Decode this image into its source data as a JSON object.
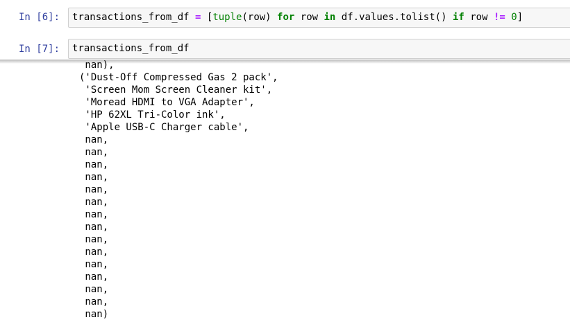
{
  "cells": [
    {
      "prompt": "In [6]:",
      "code_tokens": [
        {
          "text": "transactions_from_df ",
          "cls": ""
        },
        {
          "text": "=",
          "cls": "op"
        },
        {
          "text": " [",
          "cls": ""
        },
        {
          "text": "tuple",
          "cls": "builtin"
        },
        {
          "text": "(row) ",
          "cls": ""
        },
        {
          "text": "for",
          "cls": "kw"
        },
        {
          "text": " row ",
          "cls": ""
        },
        {
          "text": "in",
          "cls": "kw"
        },
        {
          "text": " df.values.tolist() ",
          "cls": ""
        },
        {
          "text": "if",
          "cls": "kw"
        },
        {
          "text": " row ",
          "cls": ""
        },
        {
          "text": "!=",
          "cls": "op"
        },
        {
          "text": " ",
          "cls": ""
        },
        {
          "text": "0",
          "cls": "num"
        },
        {
          "text": "]",
          "cls": ""
        }
      ]
    },
    {
      "prompt": "In [7]:",
      "code_tokens": [
        {
          "text": "transactions_from_df",
          "cls": ""
        }
      ]
    }
  ],
  "output": {
    "lines": [
      " nan),",
      "('Dust-Off Compressed Gas 2 pack',",
      " 'Screen Mom Screen Cleaner kit',",
      " 'Moread HDMI to VGA Adapter',",
      " 'HP 62XL Tri-Color ink',",
      " 'Apple USB-C Charger cable',",
      " nan,",
      " nan,",
      " nan,",
      " nan,",
      " nan,",
      " nan,",
      " nan,",
      " nan,",
      " nan,",
      " nan,",
      " nan,",
      " nan,",
      " nan,",
      " nan,",
      " nan)"
    ]
  },
  "colors": {
    "prompt": "#303F9F",
    "keyword": "#008000",
    "operator": "#AA22FF",
    "cell_background": "#f7f7f7",
    "cell_border": "#cfcfcf"
  }
}
